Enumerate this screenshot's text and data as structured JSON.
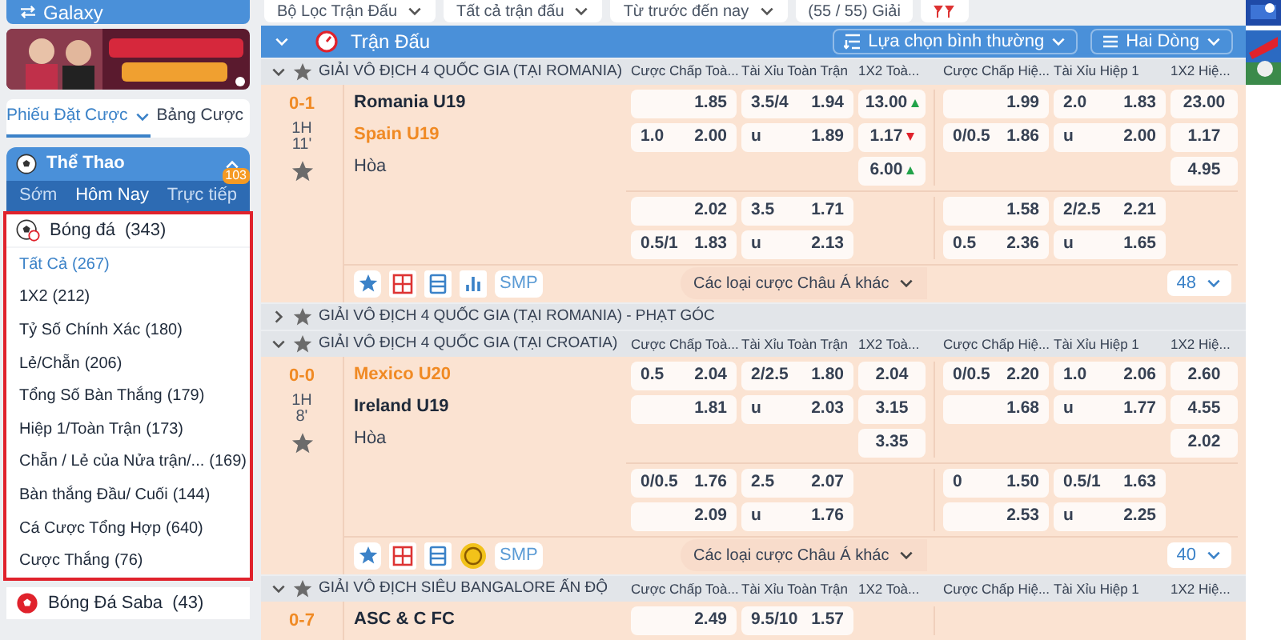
{
  "sidebar": {
    "top_item": {
      "label": "Galaxy"
    },
    "bet_tabs": [
      {
        "label": "Phiếu Đặt Cược",
        "selected": true
      },
      {
        "label": "Bảng Cược",
        "selected": false
      }
    ],
    "sports_panel": {
      "title": "Thể Thao",
      "expanded": true,
      "tabs": [
        {
          "label": "Sớm",
          "selected": false
        },
        {
          "label": "Hôm Nay",
          "selected": true
        },
        {
          "label": "Trực tiếp",
          "selected": false,
          "badge": "103"
        }
      ],
      "sport": {
        "label": "Bóng đá",
        "count": "(343)",
        "items": [
          {
            "label": "Tất Cả",
            "count": "(267)",
            "selected": true
          },
          {
            "label": "1X2",
            "count": "(212)",
            "selected": false
          },
          {
            "label": "Tỷ Số Chính Xác",
            "count": "(180)",
            "selected": false
          },
          {
            "label": "Lẻ/Chẵn",
            "count": "(206)",
            "selected": false
          },
          {
            "label": "Tổng Số Bàn Thắng",
            "count": "(179)",
            "selected": false
          },
          {
            "label": "Hiệp 1/Toàn Trận",
            "count": "(173)",
            "selected": false
          },
          {
            "label": "Chẵn / Lẻ của Nửa trận/...",
            "count": "(169)",
            "selected": false
          },
          {
            "label": "Bàn thắng Đầu/ Cuối",
            "count": "(144)",
            "selected": false
          },
          {
            "label": "Cá Cược Tổng Hợp",
            "count": "(640)",
            "selected": false
          },
          {
            "label": "Cược Thắng",
            "count": "(76)",
            "selected": false
          }
        ]
      },
      "more_sports": [
        {
          "label": "Bóng Đá Saba",
          "count": "(43)"
        }
      ]
    }
  },
  "filters": [
    {
      "label": "Bộ Lọc Trận Đấu",
      "dropdown": true
    },
    {
      "label": "Tất cả trận đấu",
      "dropdown": true
    },
    {
      "label": "Từ trước đến nay",
      "dropdown": true
    },
    {
      "label": "(55 / 55) Giải",
      "dropdown": false
    }
  ],
  "header": {
    "title": "Trận Đấu",
    "sort": "Lựa chọn bình thường",
    "view": "Hai Dòng"
  },
  "leagues": [
    {
      "name": "GIẢI VÔ ĐỊCH 4 QUỐC GIA (TẠI ROMANIA)",
      "expanded": true,
      "columns": [
        "Cược Chấp Toà...",
        "Tài Xỉu Toàn Trận",
        "1X2 Toà...",
        "Cược Chấp Hiệ...",
        "Tài Xỉu Hiệp 1",
        "1X2 Hiệ..."
      ],
      "matches": [
        {
          "score": "0-1",
          "period": "1H",
          "minute": "11'",
          "teams": [
            {
              "name": "Romania U19",
              "favorite": false
            },
            {
              "name": "Spain U19",
              "favorite": true
            }
          ],
          "draw": "Hòa",
          "groups": [
            {
              "markets": [
                {
                  "kind": "handicap",
                  "cells": [
                    {
                      "odds": "1.85"
                    },
                    {
                      "line": "1.0",
                      "odds": "2.00"
                    }
                  ]
                },
                {
                  "kind": "over_under",
                  "cells": [
                    {
                      "line": "3.5/4",
                      "odds": "1.94"
                    },
                    {
                      "line": "u",
                      "odds": "1.89"
                    }
                  ]
                },
                {
                  "kind": "result",
                  "cells": [
                    {
                      "odds": "13.00",
                      "rising": true
                    },
                    {
                      "odds": "1.17",
                      "rising": false
                    },
                    {
                      "odds": "6.00",
                      "rising": true
                    }
                  ]
                },
                {
                  "kind": "handicap",
                  "cells": [
                    {
                      "odds": "1.99"
                    },
                    {
                      "line": "0/0.5",
                      "odds": "1.86"
                    }
                  ]
                },
                {
                  "kind": "over_under",
                  "cells": [
                    {
                      "line": "2.0",
                      "odds": "1.83"
                    },
                    {
                      "line": "u",
                      "odds": "2.00"
                    }
                  ]
                },
                {
                  "kind": "result",
                  "cells": [
                    {
                      "odds": "23.00"
                    },
                    {
                      "odds": "1.17"
                    },
                    {
                      "odds": "4.95"
                    }
                  ]
                }
              ]
            },
            {
              "markets": [
                {
                  "kind": "handicap",
                  "cells": [
                    {
                      "odds": "2.02"
                    },
                    {
                      "line": "0.5/1",
                      "odds": "1.83"
                    }
                  ]
                },
                {
                  "kind": "over_under",
                  "cells": [
                    {
                      "line": "3.5",
                      "odds": "1.71"
                    },
                    {
                      "line": "u",
                      "odds": "2.13"
                    }
                  ]
                },
                {
                  "kind": "result"
                },
                {
                  "kind": "handicap",
                  "cells": [
                    {
                      "odds": "1.58"
                    },
                    {
                      "line": "0.5",
                      "odds": "2.36"
                    }
                  ]
                },
                {
                  "kind": "over_under",
                  "cells": [
                    {
                      "line": "2/2.5",
                      "odds": "2.21"
                    },
                    {
                      "line": "u",
                      "odds": "1.65"
                    }
                  ]
                },
                {
                  "kind": "result"
                }
              ]
            }
          ],
          "tools": [
            {
              "kind": "star"
            },
            {
              "kind": "scoreboard"
            },
            {
              "kind": "list"
            },
            {
              "kind": "stats"
            },
            {
              "kind": "smp",
              "label": "SMP"
            }
          ],
          "more_label": "Các loại cược Châu Á khác",
          "more_count": "48"
        }
      ]
    },
    {
      "name": "GIẢI VÔ ĐỊCH 4 QUỐC GIA (TẠI ROMANIA) - PHẠT GÓC",
      "expanded": false
    },
    {
      "name": "GIẢI VÔ ĐỊCH 4 QUỐC GIA (TẠI CROATIA)",
      "expanded": true,
      "columns": [
        "Cược Chấp Toà...",
        "Tài Xỉu Toàn Trận",
        "1X2 Toà...",
        "Cược Chấp Hiệ...",
        "Tài Xỉu Hiệp 1",
        "1X2 Hiệ..."
      ],
      "matches": [
        {
          "score": "0-0",
          "period": "1H",
          "minute": "8'",
          "teams": [
            {
              "name": "Mexico U20",
              "favorite": true
            },
            {
              "name": "Ireland U19",
              "favorite": false
            }
          ],
          "draw": "Hòa",
          "groups": [
            {
              "markets": [
                {
                  "kind": "handicap",
                  "cells": [
                    {
                      "line": "0.5",
                      "odds": "2.04"
                    },
                    {
                      "odds": "1.81"
                    }
                  ]
                },
                {
                  "kind": "over_under",
                  "cells": [
                    {
                      "line": "2/2.5",
                      "odds": "1.80"
                    },
                    {
                      "line": "u",
                      "odds": "2.03"
                    }
                  ]
                },
                {
                  "kind": "result",
                  "cells": [
                    {
                      "odds": "2.04"
                    },
                    {
                      "odds": "3.15"
                    },
                    {
                      "odds": "3.35"
                    }
                  ]
                },
                {
                  "kind": "handicap",
                  "cells": [
                    {
                      "line": "0/0.5",
                      "odds": "2.20"
                    },
                    {
                      "odds": "1.68"
                    }
                  ]
                },
                {
                  "kind": "over_under",
                  "cells": [
                    {
                      "line": "1.0",
                      "odds": "2.06"
                    },
                    {
                      "line": "u",
                      "odds": "1.77"
                    }
                  ]
                },
                {
                  "kind": "result",
                  "cells": [
                    {
                      "odds": "2.60"
                    },
                    {
                      "odds": "4.55"
                    },
                    {
                      "odds": "2.02"
                    }
                  ]
                }
              ]
            },
            {
              "markets": [
                {
                  "kind": "handicap",
                  "cells": [
                    {
                      "line": "0/0.5",
                      "odds": "1.76"
                    },
                    {
                      "odds": "2.09"
                    }
                  ]
                },
                {
                  "kind": "over_under",
                  "cells": [
                    {
                      "line": "2.5",
                      "odds": "2.07"
                    },
                    {
                      "line": "u",
                      "odds": "1.76"
                    }
                  ]
                },
                {
                  "kind": "result"
                },
                {
                  "kind": "handicap",
                  "cells": [
                    {
                      "line": "0",
                      "odds": "1.50"
                    },
                    {
                      "odds": "2.53"
                    }
                  ]
                },
                {
                  "kind": "over_under",
                  "cells": [
                    {
                      "line": "0.5/1",
                      "odds": "1.63"
                    },
                    {
                      "line": "u",
                      "odds": "2.25"
                    }
                  ]
                },
                {
                  "kind": "result"
                }
              ]
            }
          ],
          "tools": [
            {
              "kind": "star"
            },
            {
              "kind": "scoreboard"
            },
            {
              "kind": "list"
            },
            {
              "kind": "coin"
            },
            {
              "kind": "smp",
              "label": "SMP"
            }
          ],
          "more_label": "Các loại cược Châu Á khác",
          "more_count": "40"
        }
      ]
    },
    {
      "name": "GIẢI VÔ ĐỊCH SIÊU BANGALORE ẤN ĐỘ",
      "expanded": true,
      "columns": [
        "Cược Chấp Toà...",
        "Tài Xỉu Toàn Trận",
        "1X2 Toà...",
        "Cược Chấp Hiệ...",
        "Tài Xỉu Hiệp 1",
        "1X2 Hiệ..."
      ],
      "matches": [
        {
          "score": "0-7",
          "teams": [
            {
              "name": "ASC & C FC",
              "favorite": false
            }
          ],
          "groups": [
            {
              "markets": [
                {
                  "kind": "handicap",
                  "cells": [
                    {
                      "odds": "2.49"
                    }
                  ]
                },
                {
                  "kind": "over_under",
                  "cells": [
                    {
                      "line": "9.5/10",
                      "odds": "1.57"
                    }
                  ]
                },
                {
                  "kind": "result"
                },
                {
                  "kind": "handicap"
                },
                {
                  "kind": "over_under"
                },
                {
                  "kind": "result"
                }
              ]
            }
          ]
        }
      ]
    }
  ]
}
